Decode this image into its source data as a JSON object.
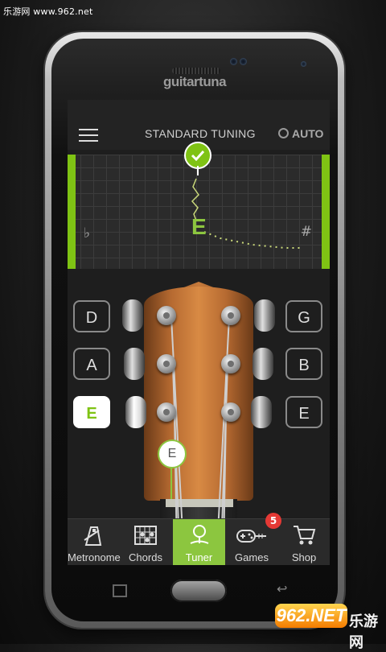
{
  "watermark_top": "乐游网 www.962.net",
  "device": {
    "brand": "guitartuna"
  },
  "header": {
    "title": "STANDARD TUNING",
    "mode": "AUTO"
  },
  "meter": {
    "note": "E",
    "flat_symbol": "♭",
    "sharp_symbol": "#",
    "status": "in-tune"
  },
  "strings": {
    "left": [
      "D",
      "A",
      "E"
    ],
    "right": [
      "G",
      "B",
      "E"
    ],
    "active": "E"
  },
  "string_pin_label": "E",
  "tabs": [
    {
      "label": "Metronome",
      "icon": "metronome-icon"
    },
    {
      "label": "Chords",
      "icon": "chords-icon"
    },
    {
      "label": "Tuner",
      "icon": "tuner-icon",
      "active": true
    },
    {
      "label": "Games",
      "icon": "gamepad-guitar-icon",
      "badge": "5"
    },
    {
      "label": "Shop",
      "icon": "cart-icon"
    }
  ],
  "watermark_bottom": {
    "logo": "962.NET",
    "text": "乐游网"
  },
  "colors": {
    "accent": "#8cc63f",
    "badge": "#e53935"
  }
}
